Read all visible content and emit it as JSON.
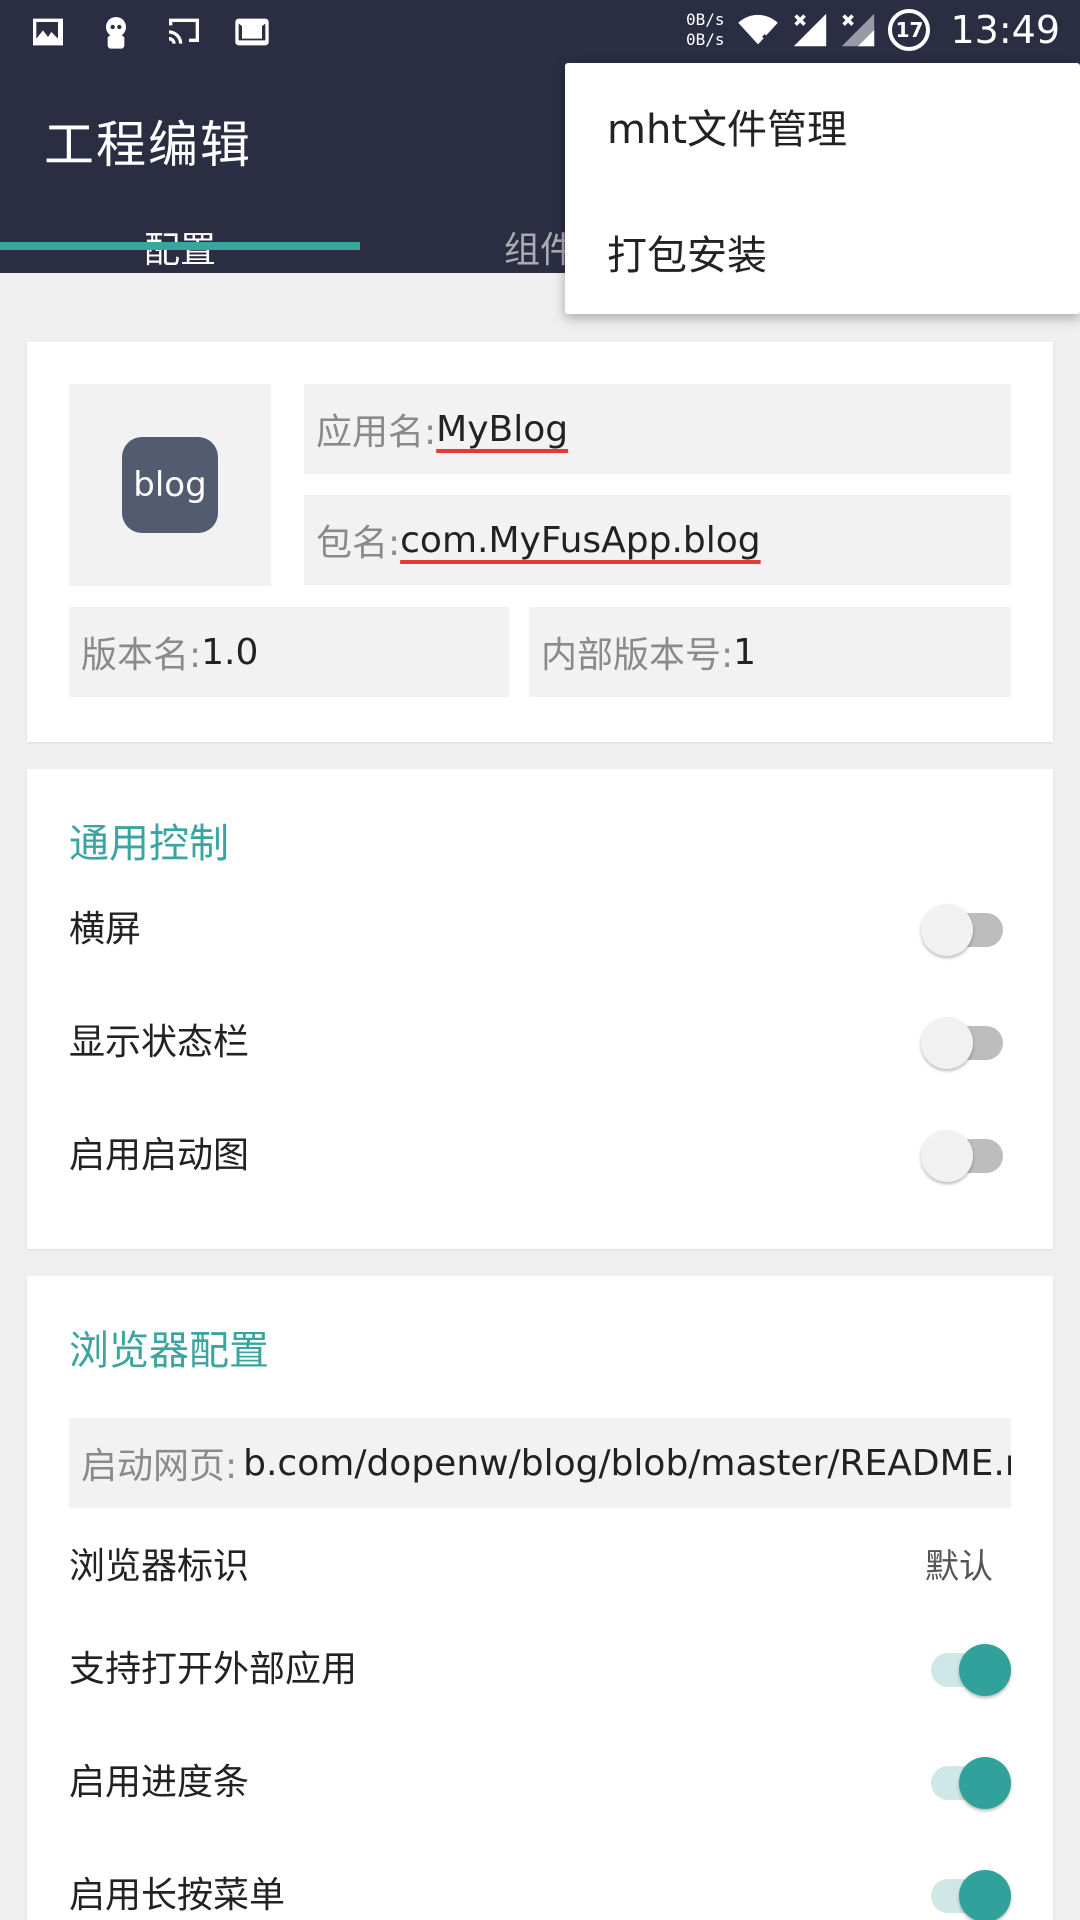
{
  "status_bar": {
    "icons": [
      "image-icon",
      "bot-icon",
      "cast-icon",
      "gmail-icon"
    ],
    "net_up": "0B/s",
    "net_down": "0B/s",
    "battery_level": "17",
    "time": "13:49"
  },
  "app_bar": {
    "title": "工程编辑",
    "tabs": [
      {
        "label": "配置",
        "selected": true
      },
      {
        "label": "组件",
        "selected": false
      }
    ]
  },
  "popup_menu": {
    "items": [
      "mht文件管理",
      "打包安装"
    ]
  },
  "app_info": {
    "icon_text": "blog",
    "app_name_label": "应用名: ",
    "app_name_value": "MyBlog",
    "package_label": "包名: ",
    "package_value": "com.MyFusApp.blog",
    "version_name_label": "版本名: ",
    "version_name_value": "1.0",
    "version_code_label": "内部版本号: ",
    "version_code_value": "1"
  },
  "general_control": {
    "title": "通用控制",
    "rows": [
      {
        "label": "横屏",
        "on": false
      },
      {
        "label": "显示状态栏",
        "on": false
      },
      {
        "label": "启用启动图",
        "on": false
      }
    ]
  },
  "browser_config": {
    "title": "浏览器配置",
    "start_page_label": "启动网页: ",
    "start_page_value": "b.com/dopenw/blog/blob/master/README.md",
    "user_agent_label": "浏览器标识",
    "user_agent_value": "默认",
    "rows": [
      {
        "label": "支持打开外部应用",
        "on": true
      },
      {
        "label": "启用进度条",
        "on": true
      },
      {
        "label": "启用长按菜单",
        "on": true
      }
    ]
  },
  "colors": {
    "app_bar": "#2b2e43",
    "accent": "#3aa59f",
    "switch_on": "#30a19b"
  }
}
